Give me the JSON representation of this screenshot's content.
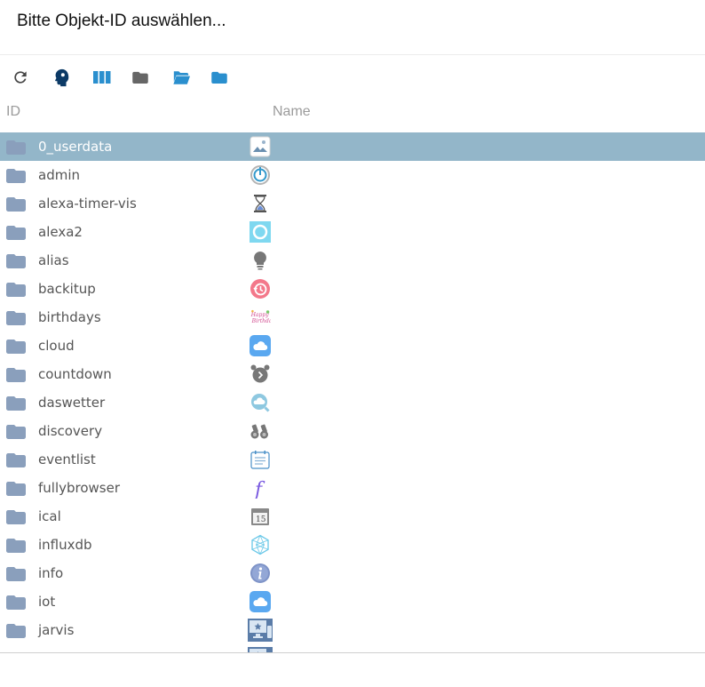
{
  "dialog": {
    "title": "Bitte Objekt-ID auswählen..."
  },
  "toolbar": [
    {
      "name": "refresh-button",
      "icon": "refresh-icon"
    },
    {
      "name": "expert-mode-button",
      "icon": "expert-head-icon"
    },
    {
      "name": "columns-button",
      "icon": "columns-icon"
    },
    {
      "name": "collapse-all-button",
      "icon": "folder-closed-icon"
    },
    {
      "name": "expand-all-button",
      "icon": "folder-open-icon"
    },
    {
      "name": "expand-one-level-button",
      "icon": "folder-blue-icon"
    }
  ],
  "columns": {
    "id": "ID",
    "name": "Name"
  },
  "tree": {
    "selected": "0_userdata",
    "rows": [
      {
        "id": "0_userdata",
        "icon": "image-icon"
      },
      {
        "id": "admin",
        "icon": "admin-power-icon"
      },
      {
        "id": "alexa-timer-vis",
        "icon": "hourglass-icon"
      },
      {
        "id": "alexa2",
        "icon": "alexa-ring-icon"
      },
      {
        "id": "alias",
        "icon": "lightbulb-icon"
      },
      {
        "id": "backitup",
        "icon": "backup-clock-icon"
      },
      {
        "id": "birthdays",
        "icon": "happy-birthday-icon"
      },
      {
        "id": "cloud",
        "icon": "cloud-icon"
      },
      {
        "id": "countdown",
        "icon": "alarm-clock-icon"
      },
      {
        "id": "daswetter",
        "icon": "weather-search-icon"
      },
      {
        "id": "discovery",
        "icon": "binoculars-icon"
      },
      {
        "id": "eventlist",
        "icon": "calendar-list-icon"
      },
      {
        "id": "fullybrowser",
        "icon": "fully-f-icon"
      },
      {
        "id": "ical",
        "icon": "calendar-15-icon"
      },
      {
        "id": "influxdb",
        "icon": "influxdb-icon"
      },
      {
        "id": "info",
        "icon": "info-icon"
      },
      {
        "id": "iot",
        "icon": "iot-cloud-icon"
      },
      {
        "id": "jarvis",
        "icon": "jarvis-monitor-icon"
      },
      {
        "id": "",
        "icon": "jarvis-monitor-icon"
      }
    ]
  },
  "colors": {
    "selected_row": "#93b6c9",
    "folder": "#8a9fbc",
    "toolbar_blue": "#2a8fce"
  }
}
